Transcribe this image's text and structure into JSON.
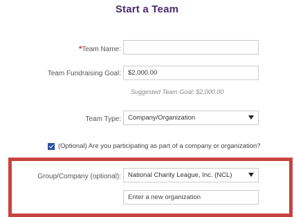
{
  "title": "Start a Team",
  "team_name": {
    "required_marker": "*",
    "label": "Team Name:",
    "value": ""
  },
  "fundraising_goal": {
    "label": "Team Fundraising Goal:",
    "value": "$2,000.00",
    "hint": "Suggested Team Goal: $2,000.00"
  },
  "team_type": {
    "label": "Team Type:",
    "selected": "Company/Organization"
  },
  "optional_checkbox": {
    "checked": true,
    "label": "(Optional) Are you participating as part of a company or organization?"
  },
  "group_company": {
    "label": "Group/Company (optional):",
    "selected": "National Charity League, Inc. (NCL)",
    "new_org_placeholder": "Enter a new organization"
  },
  "colors": {
    "title": "#4a2a6e",
    "required": "#e0202a",
    "highlight_border": "#c9423f",
    "checkbox": "#2a4fa8"
  },
  "icons": {
    "dropdown": "caret-down-icon",
    "checkbox": "checkmark-icon"
  }
}
